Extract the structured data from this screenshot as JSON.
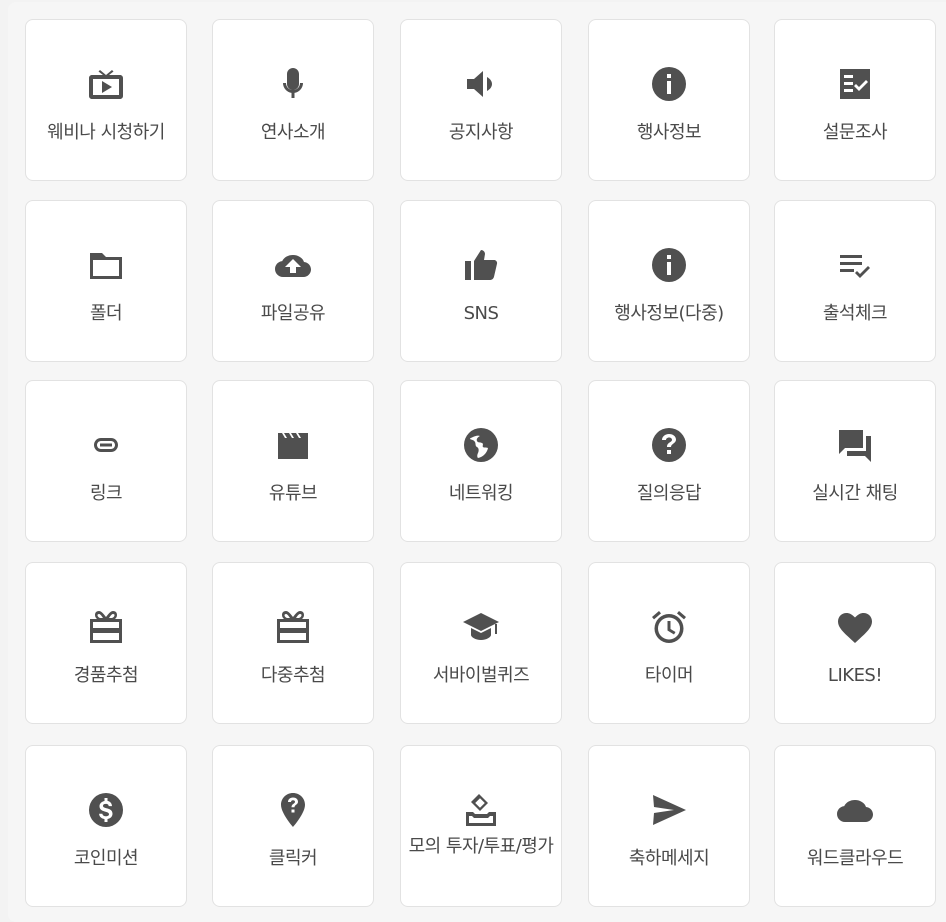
{
  "tiles": [
    {
      "label": "웨비나 시청하기",
      "icon": "tv-play-icon"
    },
    {
      "label": "연사소개",
      "icon": "microphone-icon"
    },
    {
      "label": "공지사항",
      "icon": "speaker-icon"
    },
    {
      "label": "행사정보",
      "icon": "info-icon"
    },
    {
      "label": "설문조사",
      "icon": "survey-checklist-icon"
    },
    {
      "label": "폴더",
      "icon": "folder-icon"
    },
    {
      "label": "파일공유",
      "icon": "cloud-upload-icon"
    },
    {
      "label": "SNS",
      "icon": "thumbs-up-icon"
    },
    {
      "label": "행사정보(다중)",
      "icon": "info-icon"
    },
    {
      "label": "출석체크",
      "icon": "list-check-icon"
    },
    {
      "label": "링크",
      "icon": "link-icon"
    },
    {
      "label": "유튜브",
      "icon": "clapperboard-icon"
    },
    {
      "label": "네트워킹",
      "icon": "globe-icon"
    },
    {
      "label": "질의응답",
      "icon": "question-icon"
    },
    {
      "label": "실시간 채팅",
      "icon": "chat-icon"
    },
    {
      "label": "경품추첨",
      "icon": "gift-card-icon"
    },
    {
      "label": "다중추첨",
      "icon": "gift-card-icon"
    },
    {
      "label": "서바이벌퀴즈",
      "icon": "graduation-cap-icon"
    },
    {
      "label": "타이머",
      "icon": "alarm-clock-icon"
    },
    {
      "label": "LIKES!",
      "icon": "heart-icon"
    },
    {
      "label": "코인미션",
      "icon": "dollar-coin-icon"
    },
    {
      "label": "클릭커",
      "icon": "map-pin-question-icon"
    },
    {
      "label": "모의 투자/투표/평가",
      "icon": "ballot-box-icon"
    },
    {
      "label": "축하메세지",
      "icon": "send-icon"
    },
    {
      "label": "워드클라우드",
      "icon": "cloud-icon"
    }
  ]
}
